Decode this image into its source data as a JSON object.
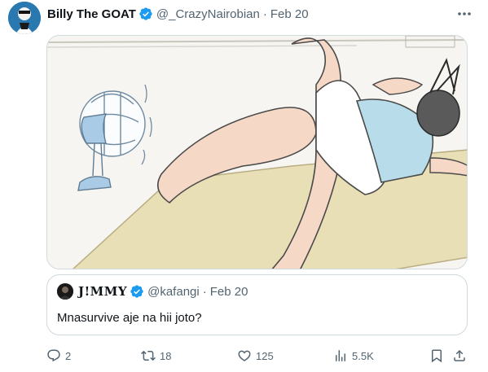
{
  "tweet": {
    "author_name": "Billy The GOAT",
    "handle": "@_CrazyNairobian",
    "separator": "·",
    "date": "Feb 20"
  },
  "quote": {
    "author_name": "J!MMY",
    "handle": "@kafangi",
    "separator": "·",
    "date": "Feb 20",
    "text": "Mnasurvive aje na hii joto?"
  },
  "actions": {
    "replies": "2",
    "retweets": "18",
    "likes": "125",
    "views": "5.5K"
  },
  "colors": {
    "verified": "#1d9bf0",
    "secondary_text": "#536471",
    "border": "#cfd9de"
  },
  "icons": [
    "verified-badge-icon",
    "more-icon",
    "reply-icon",
    "retweet-icon",
    "like-icon",
    "views-icon",
    "bookmark-icon",
    "share-icon"
  ]
}
